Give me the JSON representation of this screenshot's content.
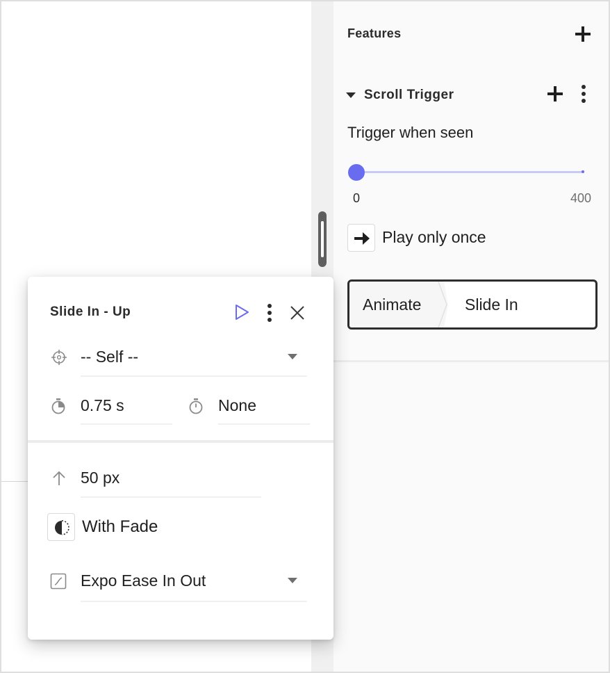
{
  "features": {
    "title": "Features",
    "add_icon": "plus-icon"
  },
  "scroll_trigger": {
    "title": "Scroll Trigger",
    "caret_icon": "caret-down-icon",
    "add_icon": "plus-icon",
    "more_icon": "more-vertical-icon",
    "trigger_label": "Trigger when seen",
    "slider": {
      "value": 0,
      "min_label": "0",
      "max_label": "400",
      "accent": "#6a6cf0"
    },
    "play_once": {
      "icon": "arrow-right-icon",
      "label": "Play only once"
    },
    "action_chip": {
      "action": "Animate",
      "animation": "Slide In"
    }
  },
  "popup": {
    "title": "Slide In - Up",
    "play_icon": "play-icon",
    "more_icon": "more-vertical-icon",
    "close_icon": "close-icon",
    "target": {
      "icon": "crosshair-icon",
      "value": "-- Self --"
    },
    "duration": {
      "icon": "timer-icon",
      "value": "0.75 s"
    },
    "delay": {
      "icon": "timer-outline-icon",
      "value": "None"
    },
    "distance": {
      "icon": "arrow-up-icon",
      "value": "50 px"
    },
    "fade": {
      "icon": "half-circle-fade-icon",
      "label": "With Fade"
    },
    "easing": {
      "icon": "easing-curve-icon",
      "value": "Expo Ease In Out"
    }
  },
  "colors": {
    "accent": "#6a6cf0",
    "panel_bg": "#fafafa",
    "text": "#1f1f1f"
  }
}
